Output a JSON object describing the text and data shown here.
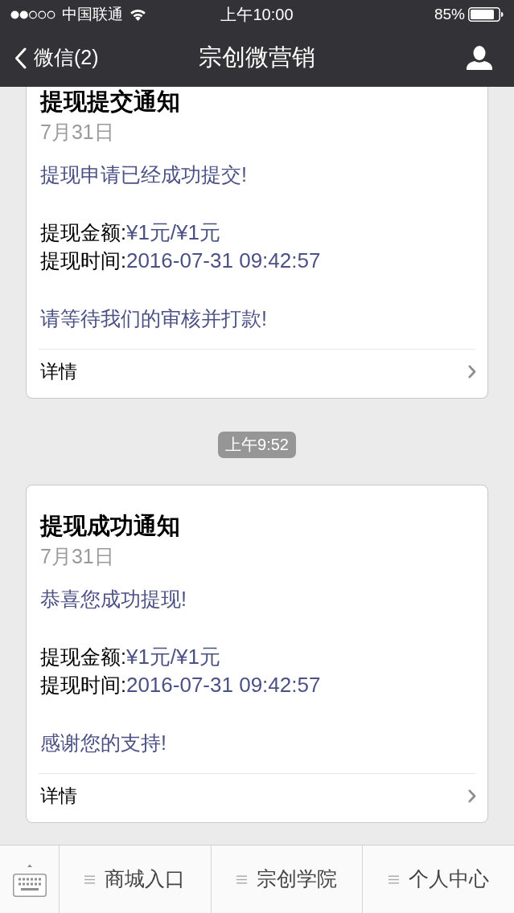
{
  "status_bar": {
    "carrier": "中国联通",
    "time": "上午10:00",
    "battery": "85%"
  },
  "nav_bar": {
    "back": "微信(2)",
    "title": "宗创微营销"
  },
  "messages": [
    {
      "kind": "card",
      "title": "提现提交通知",
      "date": "7月31日",
      "intro": "提现申请已经成功提交!",
      "fields": [
        {
          "label": "提现金额:",
          "value": "¥1元/¥1元"
        },
        {
          "label": "提现时间:",
          "value": "2016-07-31 09:42:57"
        }
      ],
      "closing": "请等待我们的审核并打款!",
      "link": "详情"
    },
    {
      "kind": "timestamp",
      "text": "上午9:52"
    },
    {
      "kind": "card",
      "title": "提现成功通知",
      "date": "7月31日",
      "intro": "恭喜您成功提现!",
      "fields": [
        {
          "label": "提现金额:",
          "value": "¥1元/¥1元"
        },
        {
          "label": "提现时间:",
          "value": "2016-07-31 09:42:57"
        }
      ],
      "closing": "感谢您的支持!",
      "link": "详情"
    }
  ],
  "menu": {
    "items": [
      "商城入口",
      "宗创学院",
      "个人中心"
    ]
  }
}
